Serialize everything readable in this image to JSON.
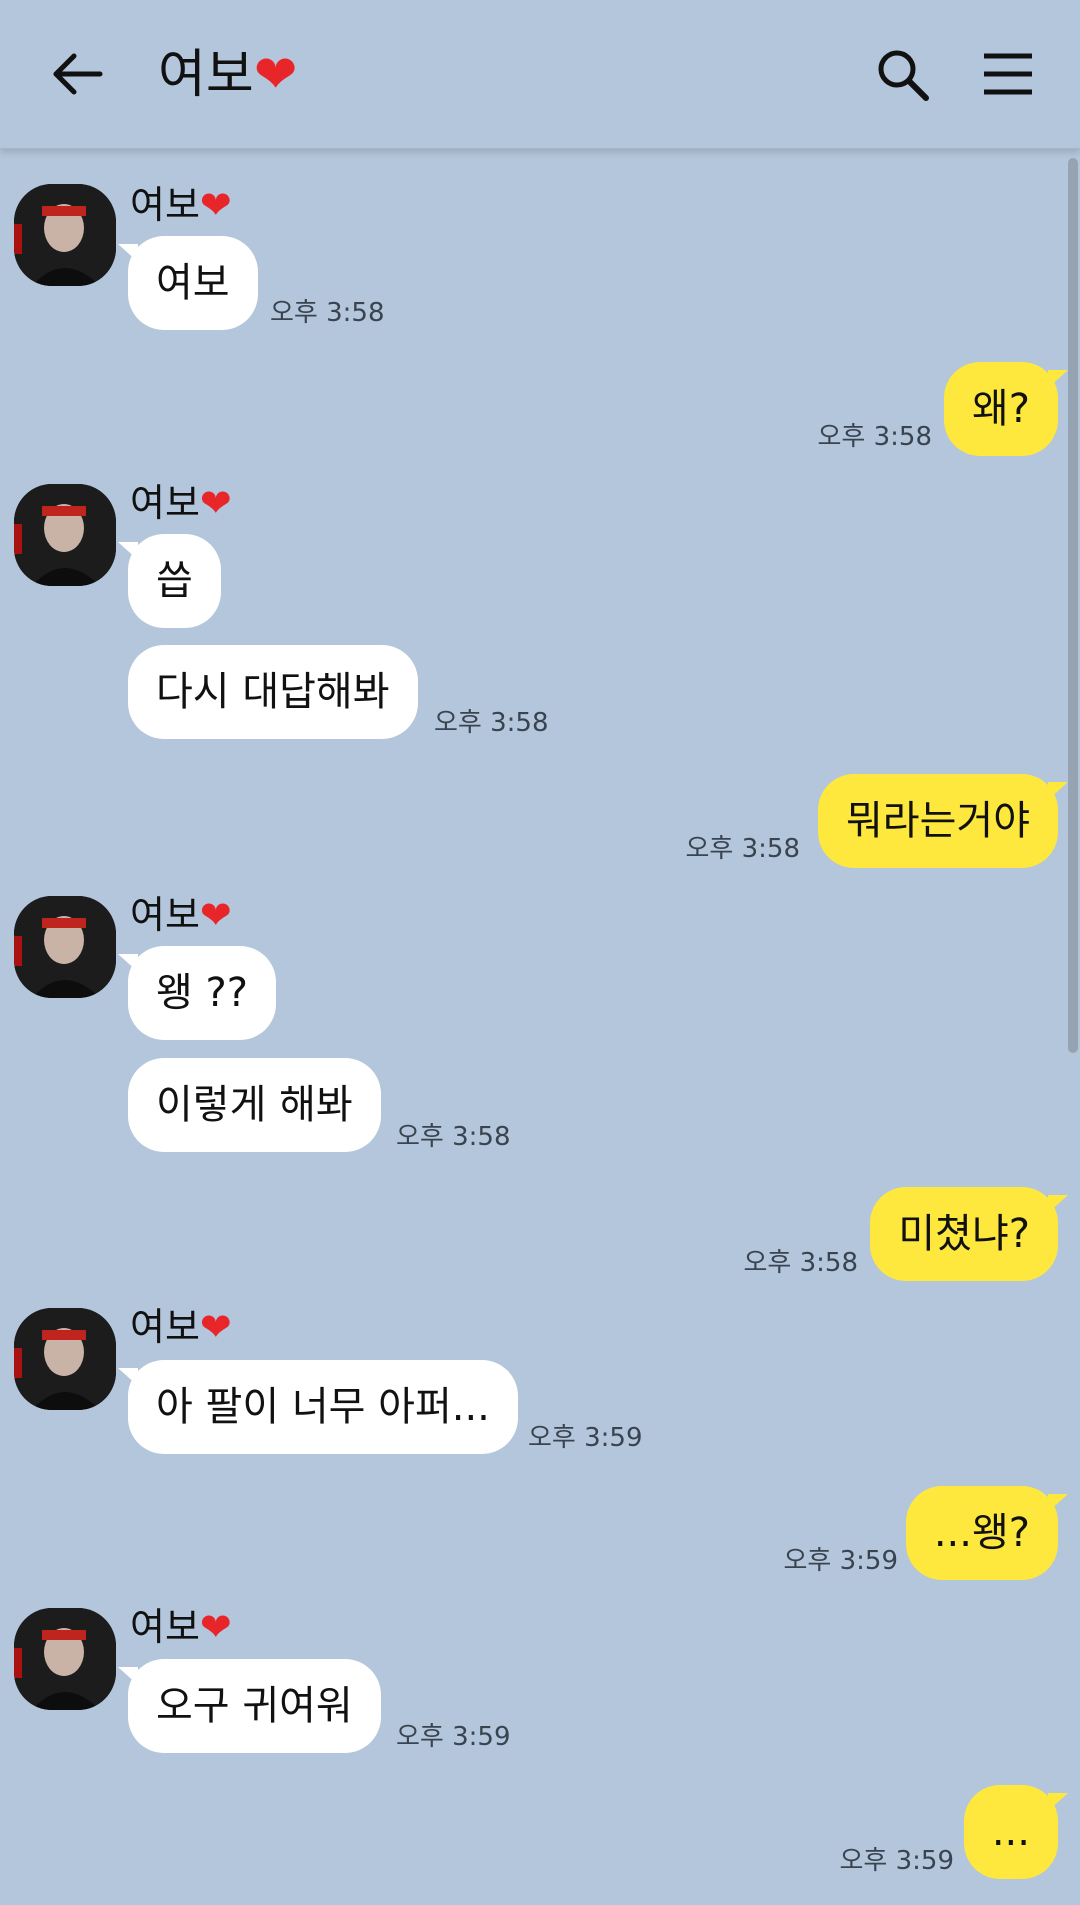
{
  "header": {
    "title": "여보",
    "title_heart": "❤"
  },
  "colors": {
    "background": "#b3c6db",
    "incoming_bubble": "#ffffff",
    "outgoing_bubble": "#fee83e",
    "heart": "#e8262a"
  },
  "contact": {
    "name": "여보",
    "heart": "❤"
  },
  "messages": [
    {
      "from": "them",
      "text": "여보",
      "time": "오후 3:58"
    },
    {
      "from": "me",
      "text": "왜?",
      "time": "오후 3:58"
    },
    {
      "from": "them",
      "text": "씁",
      "time": ""
    },
    {
      "from": "them",
      "text": "다시 대답해봐",
      "time": "오후 3:58"
    },
    {
      "from": "me",
      "text": "뭐라는거야",
      "time": "오후 3:58"
    },
    {
      "from": "them",
      "text": "왱 ??",
      "time": ""
    },
    {
      "from": "them",
      "text": "이렇게 해봐",
      "time": "오후 3:58"
    },
    {
      "from": "me",
      "text": "미쳤냐?",
      "time": "오후 3:58"
    },
    {
      "from": "them",
      "text": "아 팔이 너무 아퍼...",
      "time": "오후 3:59"
    },
    {
      "from": "me",
      "text": "...왱?",
      "time": "오후 3:59"
    },
    {
      "from": "them",
      "text": "오구 귀여워",
      "time": "오후 3:59"
    },
    {
      "from": "me",
      "text": "...",
      "time": "오후 3:59"
    }
  ]
}
